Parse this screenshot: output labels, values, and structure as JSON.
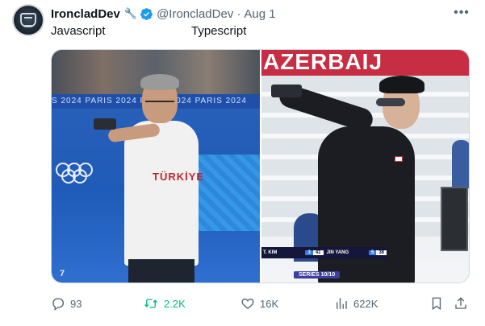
{
  "author": {
    "display_name": "IroncladDev",
    "handle": "@IroncladDev",
    "separator": "·",
    "date": "Aug 1",
    "badge_emoji_icon": "wrench-icon",
    "verified_icon": "verified-badge-icon"
  },
  "captions": {
    "left": "Javascript",
    "right": "Typescript"
  },
  "media": {
    "left_image": {
      "banner_text": "S 2024  PARIS 2024  PARIS 2024  PARIS 2024",
      "shirt_text": "TÜRKİYE",
      "corner_number": "7"
    },
    "right_image": {
      "banner_text": "AZERBAIJ",
      "scoreboard": {
        "left_name": "T. KIM",
        "left_rank": "3",
        "left_score": "41",
        "right_name": "JIN YANG",
        "right_rank": "5",
        "right_score": "38"
      },
      "series_label": "SERIES 10/10"
    }
  },
  "actions": {
    "replies": "93",
    "retweets": "2.2K",
    "likes": "16K",
    "views": "622K"
  },
  "colors": {
    "text_primary": "#0f1419",
    "text_secondary": "#536471",
    "verified": "#1d9bf0",
    "retweet_green": "#00ba7c"
  }
}
